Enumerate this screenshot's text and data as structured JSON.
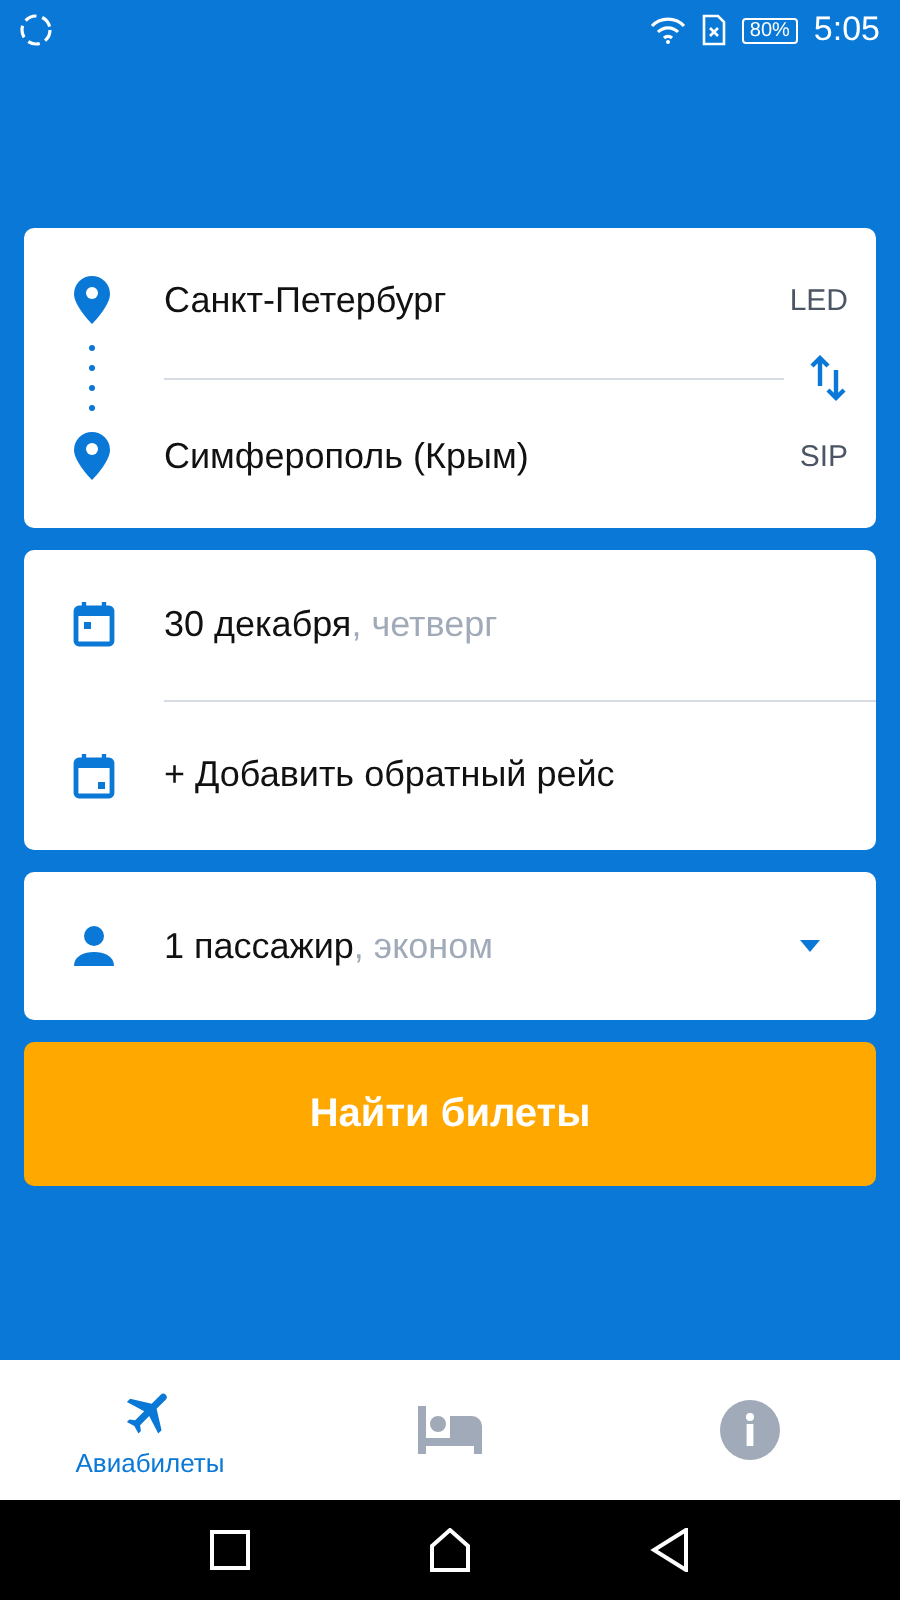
{
  "status_bar": {
    "battery": "80%",
    "time": "5:05"
  },
  "route": {
    "from": {
      "city": "Санкт-Петербург",
      "code": "LED"
    },
    "to": {
      "city": "Симферополь (Крым)",
      "code": "SIP"
    }
  },
  "dates": [
    {
      "kind": "depart",
      "main": "30 декабря",
      "extra": ", четверг"
    },
    {
      "kind": "return",
      "main": "+ Добавить обратный рейс"
    }
  ],
  "passengers": {
    "main": "1 пассажир",
    "extra": ", эконом"
  },
  "search_button": "Найти билеты",
  "tabs": [
    {
      "kind": "flights",
      "label": "Авиабилеты",
      "selected": true
    },
    {
      "kind": "hotels",
      "selected": false
    },
    {
      "kind": "info",
      "selected": false
    }
  ]
}
